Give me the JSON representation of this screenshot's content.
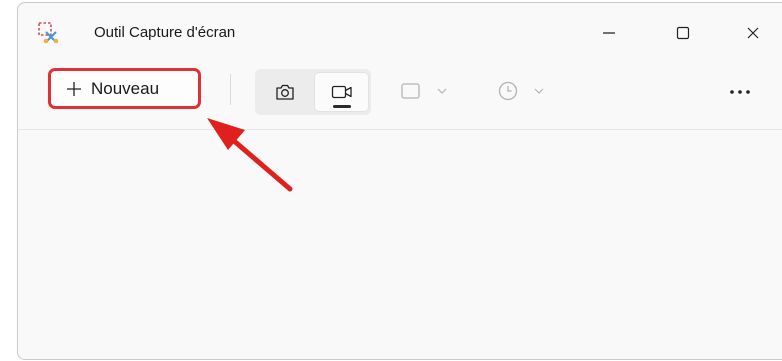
{
  "window": {
    "title": "Outil Capture d'écran",
    "icon": "snipping-tool-icon",
    "controls": [
      "minimize-icon",
      "maximize-icon",
      "close-icon"
    ]
  },
  "toolbar": {
    "new_button": {
      "label": "Nouveau",
      "icon": "plus-icon",
      "highlight_color": "#e03033"
    },
    "mode_toggle": {
      "options": [
        "camera-icon",
        "video-camera-icon"
      ],
      "selected": "video-camera-icon"
    },
    "shape_dropdown": {
      "icon": "rectangle-snip-icon"
    },
    "timer_dropdown": {
      "icon": "clock-icon"
    },
    "more_icon": "more-icon"
  },
  "annotation": {
    "type": "arrow",
    "color": "#e0201c",
    "points_to": "new_button"
  }
}
